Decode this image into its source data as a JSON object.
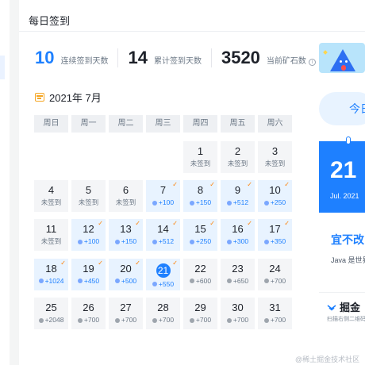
{
  "header": {
    "title": "每日签到"
  },
  "stats": [
    {
      "value": "10",
      "label": "连续签到天数"
    },
    {
      "value": "14",
      "label": "累计签到天数"
    },
    {
      "value": "3520",
      "label": "当前矿石数"
    }
  ],
  "stats_info_icon": "info-icon",
  "calendar": {
    "month_label": "2021年 7月",
    "weekdays": [
      "周日",
      "周一",
      "周二",
      "周三",
      "周四",
      "周五",
      "周六"
    ],
    "unsigned_label": "未签到",
    "days": [
      {
        "day": "1",
        "text": "未签到",
        "state": "unsigned"
      },
      {
        "day": "2",
        "text": "未签到",
        "state": "unsigned"
      },
      {
        "day": "3",
        "text": "未签到",
        "state": "unsigned"
      },
      {
        "day": "4",
        "text": "未签到",
        "state": "unsigned"
      },
      {
        "day": "5",
        "text": "未签到",
        "state": "unsigned"
      },
      {
        "day": "6",
        "text": "未签到",
        "state": "unsigned"
      },
      {
        "day": "7",
        "text": "+100",
        "state": "signed"
      },
      {
        "day": "8",
        "text": "+150",
        "state": "signed"
      },
      {
        "day": "9",
        "text": "+512",
        "state": "signed"
      },
      {
        "day": "10",
        "text": "+250",
        "state": "signed"
      },
      {
        "day": "11",
        "text": "未签到",
        "state": "unsigned"
      },
      {
        "day": "12",
        "text": "+100",
        "state": "signed"
      },
      {
        "day": "13",
        "text": "+150",
        "state": "signed"
      },
      {
        "day": "14",
        "text": "+512",
        "state": "signed"
      },
      {
        "day": "15",
        "text": "+250",
        "state": "signed"
      },
      {
        "day": "16",
        "text": "+300",
        "state": "signed"
      },
      {
        "day": "17",
        "text": "+350",
        "state": "signed"
      },
      {
        "day": "18",
        "text": "+1024",
        "state": "signed"
      },
      {
        "day": "19",
        "text": "+450",
        "state": "signed"
      },
      {
        "day": "20",
        "text": "+500",
        "state": "signed"
      },
      {
        "day": "21",
        "text": "+550",
        "state": "today"
      },
      {
        "day": "22",
        "text": "+600",
        "state": "future"
      },
      {
        "day": "23",
        "text": "+650",
        "state": "future"
      },
      {
        "day": "24",
        "text": "+700",
        "state": "future"
      },
      {
        "day": "25",
        "text": "+2048",
        "state": "future"
      },
      {
        "day": "26",
        "text": "+700",
        "state": "future"
      },
      {
        "day": "27",
        "text": "+700",
        "state": "future"
      },
      {
        "day": "28",
        "text": "+700",
        "state": "future"
      },
      {
        "day": "29",
        "text": "+700",
        "state": "future"
      },
      {
        "day": "30",
        "text": "+700",
        "state": "future"
      },
      {
        "day": "31",
        "text": "+700",
        "state": "future"
      }
    ],
    "first_weekday_index": 4
  },
  "side": {
    "today_button": "今日",
    "date_big": "21",
    "date_month": "Jul. 2021",
    "advice_title": "宜不改",
    "advice_sub": "Java 是世界",
    "brand": "掘金",
    "brand_sub": "扫描右侧二维码"
  },
  "watermark": "@稀土掘金技术社区",
  "colors": {
    "accent": "#1e80ff",
    "signed_bg": "#e8f3ff",
    "check": "#ff7d00"
  }
}
